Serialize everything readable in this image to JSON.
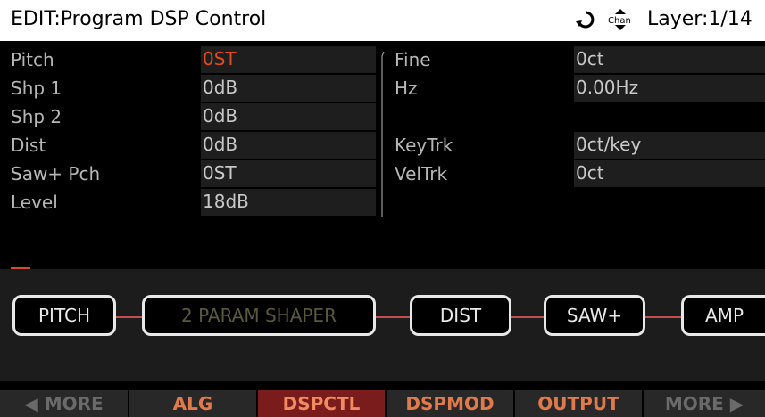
{
  "header": {
    "title": "EDIT:Program DSP Control",
    "icon_sync": "sync-arrows-icon",
    "icon_channel": "chan-icon",
    "icon_channel_text": "Chan",
    "layer": "Layer:1/14"
  },
  "params": {
    "left": [
      {
        "label": "Pitch",
        "value": "0ST",
        "active": true
      },
      {
        "label": "Shp 1",
        "value": "0dB"
      },
      {
        "label": "Shp 2",
        "value": "0dB"
      },
      {
        "label": "Dist",
        "value": "0dB"
      },
      {
        "label": "Saw+ Pch",
        "value": "0ST"
      },
      {
        "label": "Level",
        "value": "18dB"
      }
    ],
    "right": [
      {
        "label": "Fine",
        "value": "0ct"
      },
      {
        "label": "Hz",
        "value": "0.00Hz"
      },
      {
        "label": "KeyTrk",
        "value": "0ct/key"
      },
      {
        "label": "VelTrk",
        "value": "0ct"
      }
    ]
  },
  "algorithm": {
    "blocks": [
      {
        "label": "PITCH"
      },
      {
        "label": "2 PARAM SHAPER",
        "dimmed": true
      },
      {
        "label": "DIST"
      },
      {
        "label": "SAW+"
      },
      {
        "label": "AMP"
      }
    ],
    "wire_color": "#c05050"
  },
  "softkeys": [
    {
      "label": "◀ MORE"
    },
    {
      "label": "ALG"
    },
    {
      "label": "DSPCTL",
      "selected": true
    },
    {
      "label": "DSPMOD"
    },
    {
      "label": "OUTPUT"
    },
    {
      "label": "MORE ▶"
    }
  ],
  "colors": {
    "active_value": "#e04b1e",
    "softkey_selected_bg": "#7a1c1c",
    "softkey_orange": "#e07a4a"
  }
}
